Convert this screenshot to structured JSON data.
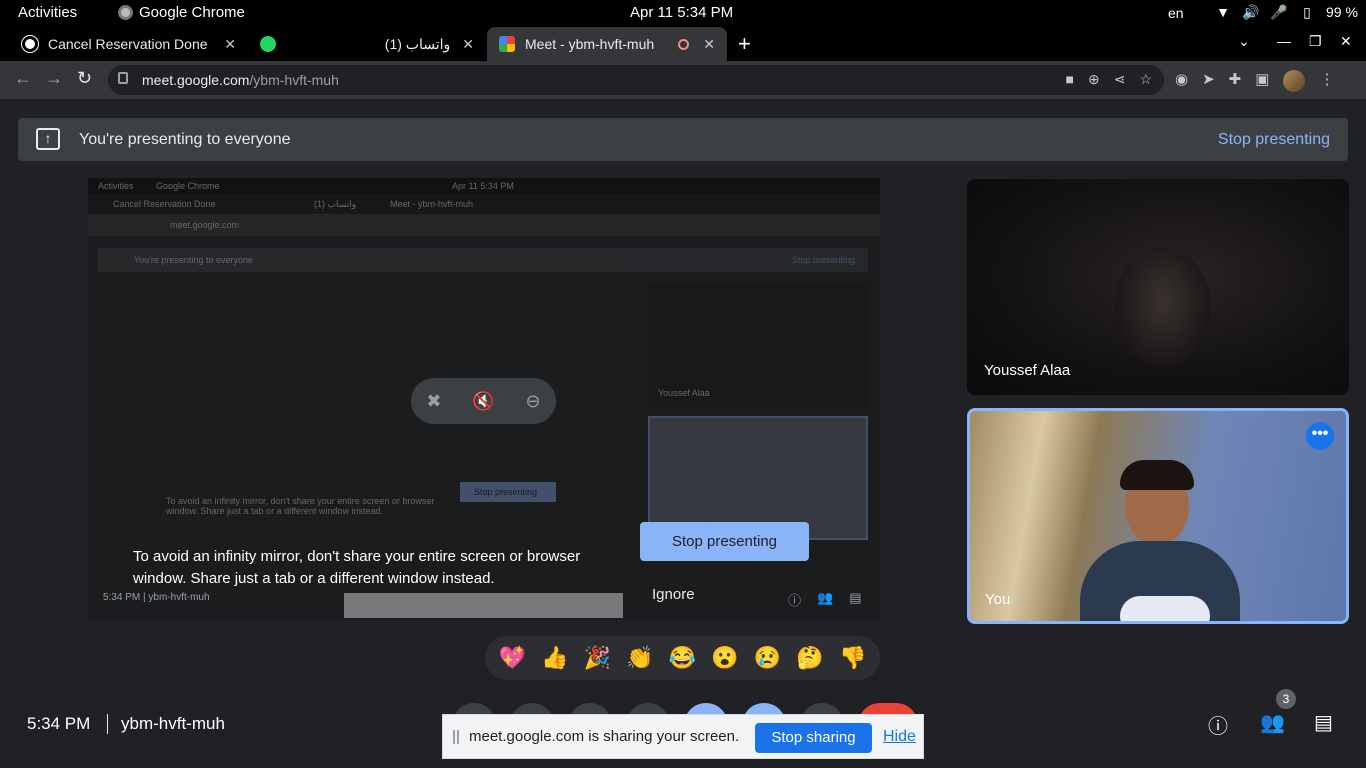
{
  "system_bar": {
    "activities": "Activities",
    "app_name": "Google Chrome",
    "clock": "Apr 11  5:34 PM",
    "language": "en",
    "battery": "99 %",
    "icons": [
      "wifi-icon",
      "volume-icon",
      "microphone-icon",
      "battery-icon"
    ]
  },
  "tabs": [
    {
      "title": "Cancel Reservation Done",
      "icon": "github-icon",
      "active": false
    },
    {
      "title": "(1) واتساب",
      "icon": "whatsapp-icon",
      "active": false
    },
    {
      "title": "Meet - ybm-hvft-muh",
      "icon": "meet-icon",
      "active": true
    }
  ],
  "address_bar": {
    "host": "meet.google.com",
    "path": "/ybm-hvft-muh"
  },
  "presenting_banner": {
    "title": "You're presenting to everyone",
    "stop_label": "Stop presenting"
  },
  "mirror": {
    "warning": "To avoid an infinity mirror, don't share your entire screen or browser window. Share just a tab or a different window instead.",
    "stop_label": "Stop presenting",
    "ignore_label": "Ignore",
    "footer_time": "5:34 PM",
    "footer_code": "ybm-hvft-muh",
    "inner_clock": "Apr 11  5:34 PM",
    "inner_banner": "You're presenting to everyone",
    "inner_stop": "Stop presenting",
    "inner_name": "Youssef Alaa",
    "inner_share_text": "meet.google.com is sharing your screen.",
    "inner_share_stop": "Stop sharing",
    "inner_share_hide": "Hide",
    "inner_badge": "3"
  },
  "participants": [
    {
      "name": "Youssef Alaa"
    },
    {
      "name": "You"
    }
  ],
  "reactions": [
    "💖",
    "👍",
    "🎉",
    "👏",
    "😂",
    "😮",
    "😢",
    "🤔",
    "👎"
  ],
  "meeting": {
    "time": "5:34 PM",
    "code": "ybm-hvft-muh",
    "people_count": "3"
  },
  "share_bar": {
    "text": "meet.google.com is sharing your screen.",
    "stop_label": "Stop sharing",
    "hide_label": "Hide"
  },
  "colors": {
    "accent": "#8ab4f8",
    "button_blue": "#1a73e8",
    "background": "#202124"
  }
}
